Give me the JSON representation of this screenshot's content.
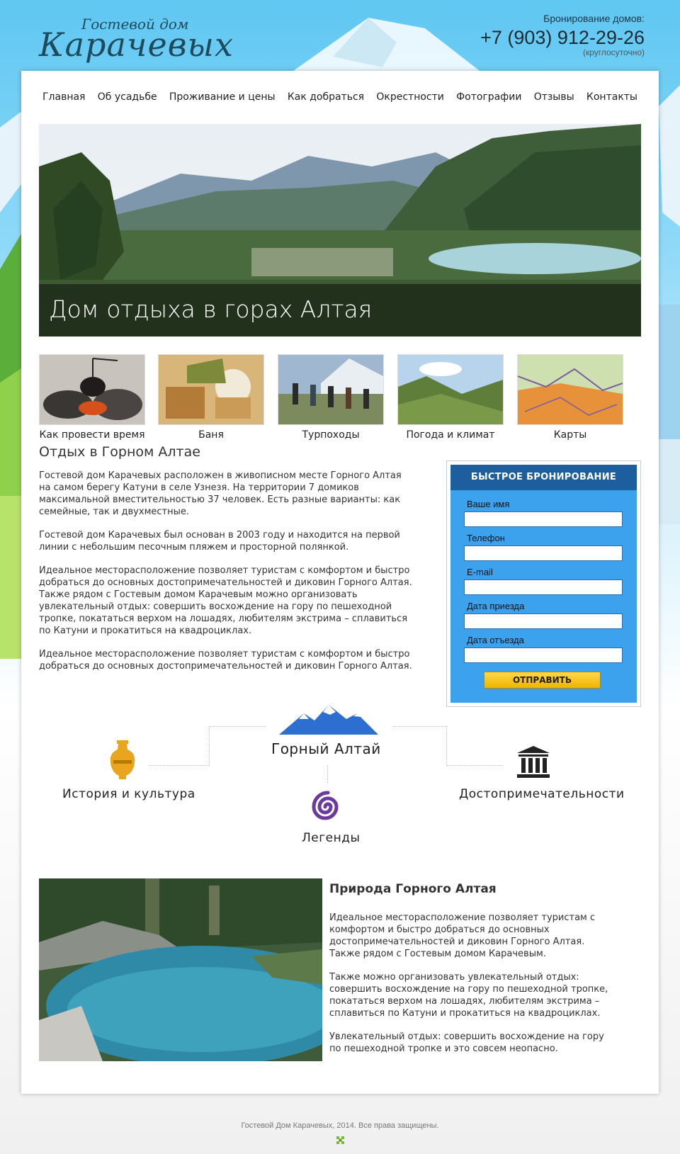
{
  "header": {
    "logo_top": "Гостевой дом",
    "logo_main": "Карачевых",
    "booking_label": "Бронирование домов:",
    "phone": "+7 (903) 912-29-26",
    "phone_note": "(круглосуточно)"
  },
  "nav": {
    "items": [
      "Главная",
      "Об усадьбе",
      "Проживание и цены",
      "Как добраться",
      "Окрестности",
      "Фотографии",
      "Отзывы",
      "Контакты"
    ]
  },
  "hero": {
    "title": "Дом отдыха в горах Алтая"
  },
  "thumbs": {
    "items": [
      "Как провести время",
      "Баня",
      "Турпоходы",
      "Погода и климат",
      "Карты"
    ]
  },
  "content": {
    "title": "Отдых в Горном Алтае",
    "paragraphs": [
      "Гостевой дом Карачевых расположен в живописном месте Горного Алтая на самом берегу Катуни в селе Узнезя. На территории 7 домиков максимальной вместительностью 37 человек. Есть разные варианты: как семейные, так и двухместные.",
      "Гостевой дом Карачевых был основан в 2003 году и находится на первой линии с небольшим песочным пляжем и просторной полянкой.",
      "Идеальное месторасположение позволяет туристам с комфортом и быстро добраться до основных достопримечательностей и диковин Горного Алтая. Также рядом с Гостевым домом Карачевым можно организовать увлекательный отдых: совершить восхождение на гору по пешеходной тропке, покататься верхом на лошадях, любителям экстрима – сплавиться по Катуни и прокатиться на квадроциклах.",
      "Идеальное месторасположение позволяет туристам с комфортом и быстро добраться до основных достопримечательностей и диковин Горного Алтая."
    ]
  },
  "quick_booking": {
    "title": "БЫСТРОЕ БРОНИРОВАНИЕ",
    "fields": [
      "Ваше имя",
      "Телефон",
      "E-mail",
      "Дата приезда",
      "Дата отъезда"
    ],
    "submit": "ОТПРАВИТЬ"
  },
  "features": {
    "center": "Горный Алтай",
    "history": "История и культура",
    "sights": "Достопримечательности",
    "legends": "Легенды"
  },
  "nature": {
    "title": "Природа Горного Алтая",
    "paragraphs": [
      "Идеальное месторасположение позволяет туристам с комфортом и быстро добраться до основных достопримечательностей и диковин Горного Алтая. Также рядом с Гостевым домом Карачевым.",
      "Также можно организовать увлекательный отдых: совершить восхождение на гору по пешеходной тропке, покататься верхом на лошадях, любителям экстрима – сплавиться по Катуни и прокатиться на квадроциклах.",
      "Увлекательный отдых: совершить восхождение на гору по пешеходной тропке и это совсем неопасно."
    ]
  },
  "footer": {
    "copyright": "Гостевой Дом Карачевых, 2014. Все права защищены."
  },
  "colors": {
    "booking_panel": "#3da2ee",
    "booking_title_bg": "#1d5e9e",
    "submit_button": "#f0b400",
    "mountain_icon": "#2c6fd1",
    "vase_icon": "#e8a51d",
    "spiral_icon": "#6a3a9c"
  },
  "icons": {
    "features": [
      "mountain-icon",
      "vase-icon",
      "columns-icon",
      "spiral-icon"
    ]
  }
}
